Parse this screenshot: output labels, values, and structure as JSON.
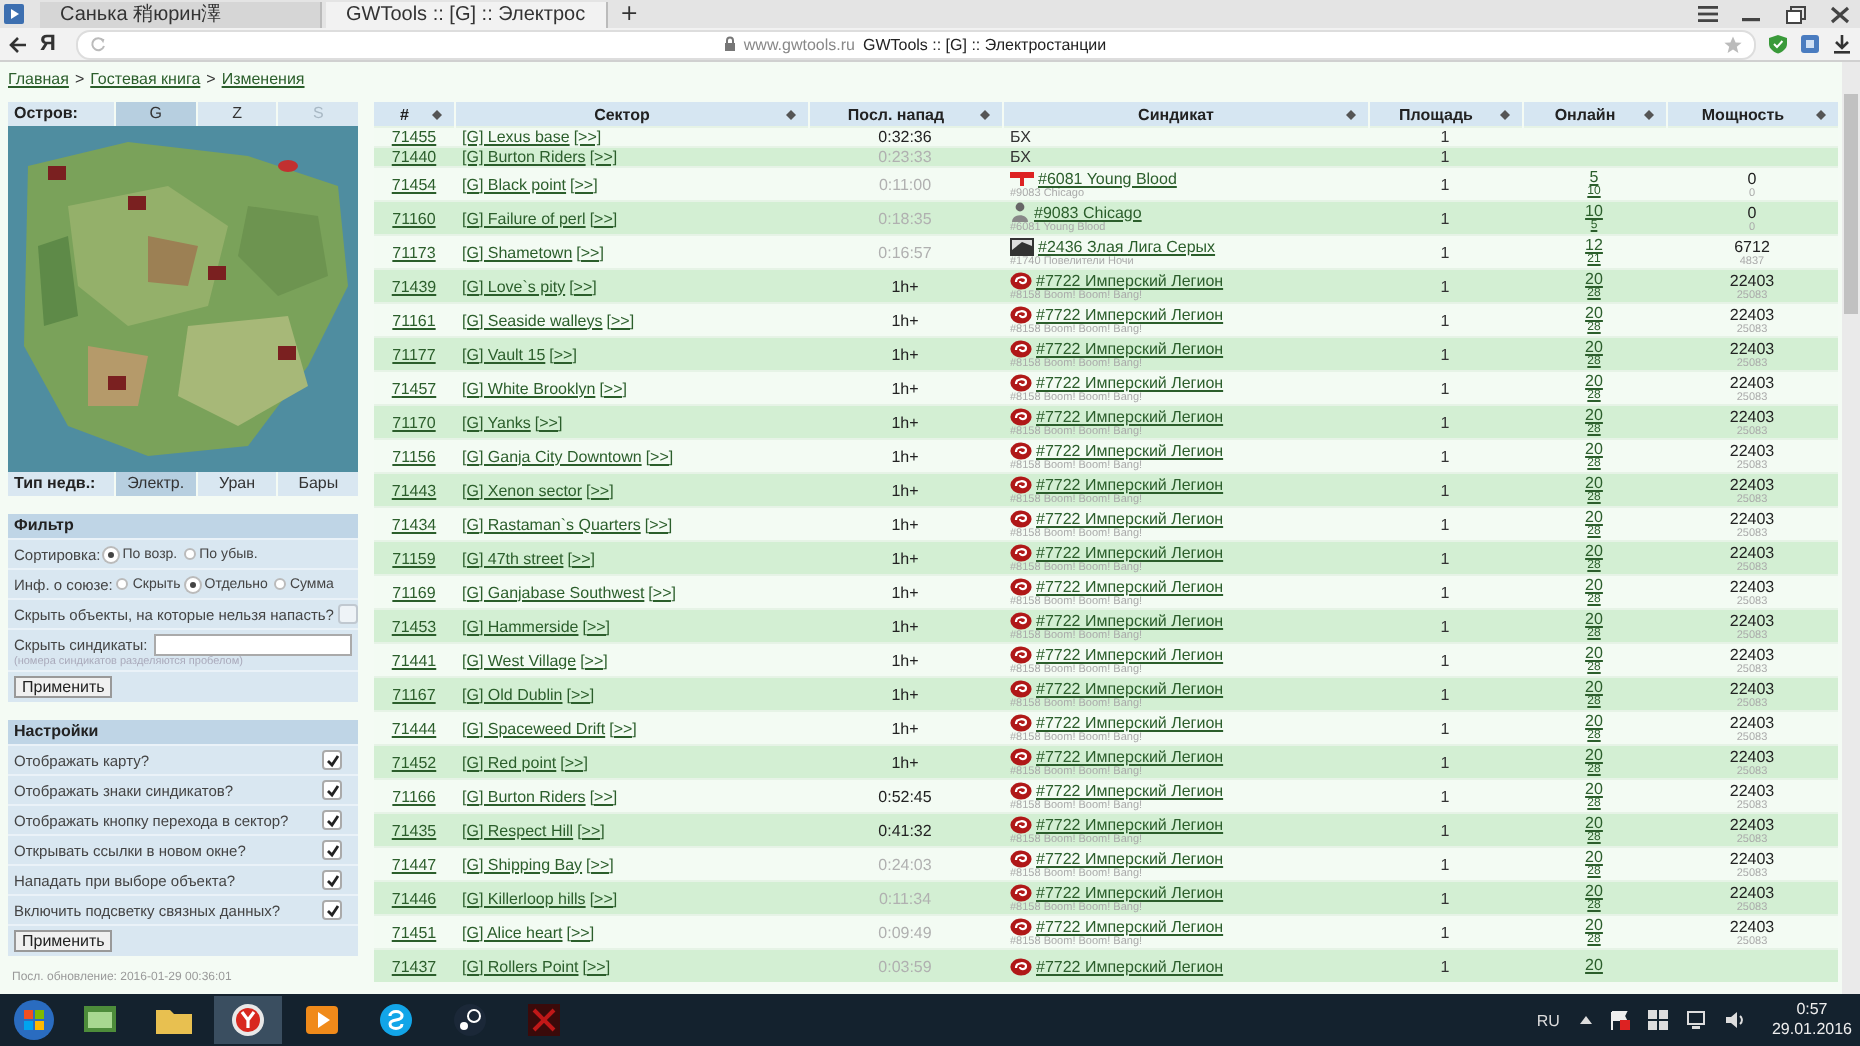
{
  "browser": {
    "tabs": [
      {
        "title": "Санька 稍юрин澤",
        "selected": false
      },
      {
        "title": "GWTools :: [G] :: Электрос",
        "selected": true
      }
    ],
    "new_tab": "+",
    "logo": "Я",
    "address": {
      "domain": "www.gwtools.ru",
      "title": "GWTools :: [G] :: Электростанции"
    }
  },
  "breadcrumb": {
    "items": [
      "Главная",
      "Гостевая книга",
      "Изменения"
    ],
    "separators": [
      ">",
      ">"
    ]
  },
  "island": {
    "label": "Остров:",
    "tabs": [
      {
        "label": "G",
        "selected": true,
        "disabled": false
      },
      {
        "label": "Z",
        "selected": false,
        "disabled": false
      },
      {
        "label": "S",
        "selected": false,
        "disabled": true
      }
    ]
  },
  "property_type": {
    "label": "Тип недв.:",
    "tabs": [
      {
        "label": "Электр.",
        "selected": true
      },
      {
        "label": "Уран",
        "selected": false
      },
      {
        "label": "Бары",
        "selected": false
      }
    ]
  },
  "filter": {
    "title": "Фильтр",
    "sort": {
      "label": "Сортировка:",
      "options": [
        {
          "label": "По возр.",
          "selected": true
        },
        {
          "label": "По убыв.",
          "selected": false
        }
      ]
    },
    "union": {
      "label": "Инф. о союзе:",
      "options": [
        {
          "label": "Скрыть",
          "selected": false
        },
        {
          "label": "Отдельно",
          "selected": true
        },
        {
          "label": "Сумма",
          "selected": false
        }
      ]
    },
    "hide_unattackable": {
      "label": "Скрыть объекты, на которые нельзя напасть?",
      "checked": false
    },
    "hide_syndicates": {
      "label": "Скрыть синдикаты:",
      "hint": "(номера синдикатов разделяются пробелом)"
    },
    "button": "Применить"
  },
  "settings": {
    "title": "Настройки",
    "items": [
      {
        "label": "Отображать карту?",
        "checked": true
      },
      {
        "label": "Отображать знаки синдикатов?",
        "checked": true
      },
      {
        "label": "Отображать кнопку перехода в сектор?",
        "checked": true
      },
      {
        "label": "Открывать ссылки в новом окне?",
        "checked": true
      },
      {
        "label": "Нападать при выборе объекта?",
        "checked": true
      },
      {
        "label": "Включить подсветку связных данных?",
        "checked": true
      }
    ],
    "button": "Применить"
  },
  "last_update": "Посл. обновление: 2016-01-29 00:36:01",
  "table": {
    "columns": [
      "#",
      "Сектор",
      "Посл. напад",
      "Синдикат",
      "Площадь",
      "Онлайн",
      "Мощность"
    ],
    "rows": [
      {
        "id": "71455",
        "sector": "[G] Lexus base",
        "go": "[>>]",
        "last_attack": "0:32:36",
        "muted": false,
        "syndicate": {
          "kind": "text",
          "name": "БХ"
        },
        "area": "1"
      },
      {
        "id": "71440",
        "sector": "[G] Burton Riders",
        "go": "[>>]",
        "last_attack": "0:23:33",
        "muted": true,
        "syndicate": {
          "kind": "text",
          "name": "БХ"
        },
        "area": "1"
      },
      {
        "id": "71454",
        "sector": "[G] Black point",
        "go": "[>>]",
        "last_attack": "0:11:00",
        "muted": true,
        "syndicate": {
          "kind": "flag",
          "name": "#6081 Young Blood",
          "ally": "#9083 Chicago"
        },
        "area": "1",
        "online": "5",
        "online_ally": "10",
        "power": "0",
        "power_ally": "0"
      },
      {
        "id": "71160",
        "sector": "[G] Failure of perl",
        "go": "[>>]",
        "last_attack": "0:18:35",
        "muted": true,
        "syndicate": {
          "kind": "figure",
          "name": "#9083 Chicago",
          "ally": "#6081 Young Blood"
        },
        "area": "1",
        "online": "10",
        "online_ally": "5",
        "power": "0",
        "power_ally": "0"
      },
      {
        "id": "71173",
        "sector": "[G] Shametown",
        "go": "[>>]",
        "last_attack": "0:16:57",
        "muted": true,
        "syndicate": {
          "kind": "banner",
          "name": "#2436 Злая Лига Серых",
          "ally": "#1740 Повелители Ночи"
        },
        "area": "1",
        "online": "12",
        "online_ally": "21",
        "power": "6712",
        "power_ally": "4837"
      },
      {
        "id": "71439",
        "sector": "[G] Love`s pity",
        "go": "[>>]",
        "last_attack": "1h+",
        "muted": false,
        "syndicate": {
          "kind": "emblem",
          "name": "#7722 Имперский Легион",
          "ally": "#8158 Boom! Boom! Bang!"
        },
        "area": "1",
        "online": "20",
        "online_ally": "28",
        "power": "22403",
        "power_ally": "25083"
      },
      {
        "id": "71161",
        "sector": "[G] Seaside walleys",
        "go": "[>>]",
        "last_attack": "1h+",
        "muted": false,
        "syndicate": {
          "kind": "emblem",
          "name": "#7722 Имперский Легион",
          "ally": "#8158 Boom! Boom! Bang!"
        },
        "area": "1",
        "online": "20",
        "online_ally": "28",
        "power": "22403",
        "power_ally": "25083"
      },
      {
        "id": "71177",
        "sector": "[G] Vault 15",
        "go": "[>>]",
        "last_attack": "1h+",
        "muted": false,
        "syndicate": {
          "kind": "emblem",
          "name": "#7722 Имперский Легион",
          "ally": "#8158 Boom! Boom! Bang!"
        },
        "area": "1",
        "online": "20",
        "online_ally": "28",
        "power": "22403",
        "power_ally": "25083"
      },
      {
        "id": "71457",
        "sector": "[G] White Brooklyn",
        "go": "[>>]",
        "last_attack": "1h+",
        "muted": false,
        "syndicate": {
          "kind": "emblem",
          "name": "#7722 Имперский Легион",
          "ally": "#8158 Boom! Boom! Bang!"
        },
        "area": "1",
        "online": "20",
        "online_ally": "28",
        "power": "22403",
        "power_ally": "25083"
      },
      {
        "id": "71170",
        "sector": "[G] Yanks",
        "go": "[>>]",
        "last_attack": "1h+",
        "muted": false,
        "syndicate": {
          "kind": "emblem",
          "name": "#7722 Имперский Легион",
          "ally": "#8158 Boom! Boom! Bang!"
        },
        "area": "1",
        "online": "20",
        "online_ally": "28",
        "power": "22403",
        "power_ally": "25083"
      },
      {
        "id": "71156",
        "sector": "[G] Ganja City Downtown",
        "go": "[>>]",
        "last_attack": "1h+",
        "muted": false,
        "syndicate": {
          "kind": "emblem",
          "name": "#7722 Имперский Легион",
          "ally": "#8158 Boom! Boom! Bang!"
        },
        "area": "1",
        "online": "20",
        "online_ally": "28",
        "power": "22403",
        "power_ally": "25083"
      },
      {
        "id": "71443",
        "sector": "[G] Xenon sector",
        "go": "[>>]",
        "last_attack": "1h+",
        "muted": false,
        "syndicate": {
          "kind": "emblem",
          "name": "#7722 Имперский Легион",
          "ally": "#8158 Boom! Boom! Bang!"
        },
        "area": "1",
        "online": "20",
        "online_ally": "28",
        "power": "22403",
        "power_ally": "25083"
      },
      {
        "id": "71434",
        "sector": "[G] Rastaman`s Quarters",
        "go": "[>>]",
        "last_attack": "1h+",
        "muted": false,
        "syndicate": {
          "kind": "emblem",
          "name": "#7722 Имперский Легион",
          "ally": "#8158 Boom! Boom! Bang!"
        },
        "area": "1",
        "online": "20",
        "online_ally": "28",
        "power": "22403",
        "power_ally": "25083"
      },
      {
        "id": "71159",
        "sector": "[G] 47th street",
        "go": "[>>]",
        "last_attack": "1h+",
        "muted": false,
        "syndicate": {
          "kind": "emblem",
          "name": "#7722 Имперский Легион",
          "ally": "#8158 Boom! Boom! Bang!"
        },
        "area": "1",
        "online": "20",
        "online_ally": "28",
        "power": "22403",
        "power_ally": "25083"
      },
      {
        "id": "71169",
        "sector": "[G] Ganjabase Southwest",
        "go": "[>>]",
        "last_attack": "1h+",
        "muted": false,
        "syndicate": {
          "kind": "emblem",
          "name": "#7722 Имперский Легион",
          "ally": "#8158 Boom! Boom! Bang!"
        },
        "area": "1",
        "online": "20",
        "online_ally": "28",
        "power": "22403",
        "power_ally": "25083"
      },
      {
        "id": "71453",
        "sector": "[G] Hammerside",
        "go": "[>>]",
        "last_attack": "1h+",
        "muted": false,
        "syndicate": {
          "kind": "emblem",
          "name": "#7722 Имперский Легион",
          "ally": "#8158 Boom! Boom! Bang!"
        },
        "area": "1",
        "online": "20",
        "online_ally": "28",
        "power": "22403",
        "power_ally": "25083"
      },
      {
        "id": "71441",
        "sector": "[G] West Village",
        "go": "[>>]",
        "last_attack": "1h+",
        "muted": false,
        "syndicate": {
          "kind": "emblem",
          "name": "#7722 Имперский Легион",
          "ally": "#8158 Boom! Boom! Bang!"
        },
        "area": "1",
        "online": "20",
        "online_ally": "28",
        "power": "22403",
        "power_ally": "25083"
      },
      {
        "id": "71167",
        "sector": "[G] Old Dublin",
        "go": "[>>]",
        "last_attack": "1h+",
        "muted": false,
        "syndicate": {
          "kind": "emblem",
          "name": "#7722 Имперский Легион",
          "ally": "#8158 Boom! Boom! Bang!"
        },
        "area": "1",
        "online": "20",
        "online_ally": "28",
        "power": "22403",
        "power_ally": "25083"
      },
      {
        "id": "71444",
        "sector": "[G] Spaceweed Drift",
        "go": "[>>]",
        "last_attack": "1h+",
        "muted": false,
        "syndicate": {
          "kind": "emblem",
          "name": "#7722 Имперский Легион",
          "ally": "#8158 Boom! Boom! Bang!"
        },
        "area": "1",
        "online": "20",
        "online_ally": "28",
        "power": "22403",
        "power_ally": "25083"
      },
      {
        "id": "71452",
        "sector": "[G] Red point",
        "go": "[>>]",
        "last_attack": "1h+",
        "muted": false,
        "syndicate": {
          "kind": "emblem",
          "name": "#7722 Имперский Легион",
          "ally": "#8158 Boom! Boom! Bang!"
        },
        "area": "1",
        "online": "20",
        "online_ally": "28",
        "power": "22403",
        "power_ally": "25083"
      },
      {
        "id": "71166",
        "sector": "[G] Burton Riders",
        "go": "[>>]",
        "last_attack": "0:52:45",
        "muted": false,
        "syndicate": {
          "kind": "emblem",
          "name": "#7722 Имперский Легион",
          "ally": "#8158 Boom! Boom! Bang!"
        },
        "area": "1",
        "online": "20",
        "online_ally": "28",
        "power": "22403",
        "power_ally": "25083"
      },
      {
        "id": "71435",
        "sector": "[G] Respect Hill",
        "go": "[>>]",
        "last_attack": "0:41:32",
        "muted": false,
        "syndicate": {
          "kind": "emblem",
          "name": "#7722 Имперский Легион",
          "ally": "#8158 Boom! Boom! Bang!"
        },
        "area": "1",
        "online": "20",
        "online_ally": "28",
        "power": "22403",
        "power_ally": "25083"
      },
      {
        "id": "71447",
        "sector": "[G] Shipping Bay",
        "go": "[>>]",
        "last_attack": "0:24:03",
        "muted": true,
        "syndicate": {
          "kind": "emblem",
          "name": "#7722 Имперский Легион",
          "ally": "#8158 Boom! Boom! Bang!"
        },
        "area": "1",
        "online": "20",
        "online_ally": "28",
        "power": "22403",
        "power_ally": "25083"
      },
      {
        "id": "71446",
        "sector": "[G] Killerloop hills",
        "go": "[>>]",
        "last_attack": "0:11:34",
        "muted": true,
        "syndicate": {
          "kind": "emblem",
          "name": "#7722 Имперский Легион",
          "ally": "#8158 Boom! Boom! Bang!"
        },
        "area": "1",
        "online": "20",
        "online_ally": "28",
        "power": "22403",
        "power_ally": "25083"
      },
      {
        "id": "71451",
        "sector": "[G] Alice heart",
        "go": "[>>]",
        "last_attack": "0:09:49",
        "muted": true,
        "syndicate": {
          "kind": "emblem",
          "name": "#7722 Имперский Легион",
          "ally": "#8158 Boom! Boom! Bang!"
        },
        "area": "1",
        "online": "20",
        "online_ally": "28",
        "power": "22403",
        "power_ally": "25083"
      },
      {
        "id": "71437",
        "sector": "[G] Rollers Point",
        "go": "[>>]",
        "last_attack": "0:03:59",
        "muted": true,
        "syndicate": {
          "kind": "emblem",
          "name": "#7722 Имперский Легион"
        },
        "area": "1",
        "online": "20"
      }
    ]
  },
  "taskbar": {
    "language": "RU",
    "time": "0:57",
    "date": "29.01.2016"
  }
}
